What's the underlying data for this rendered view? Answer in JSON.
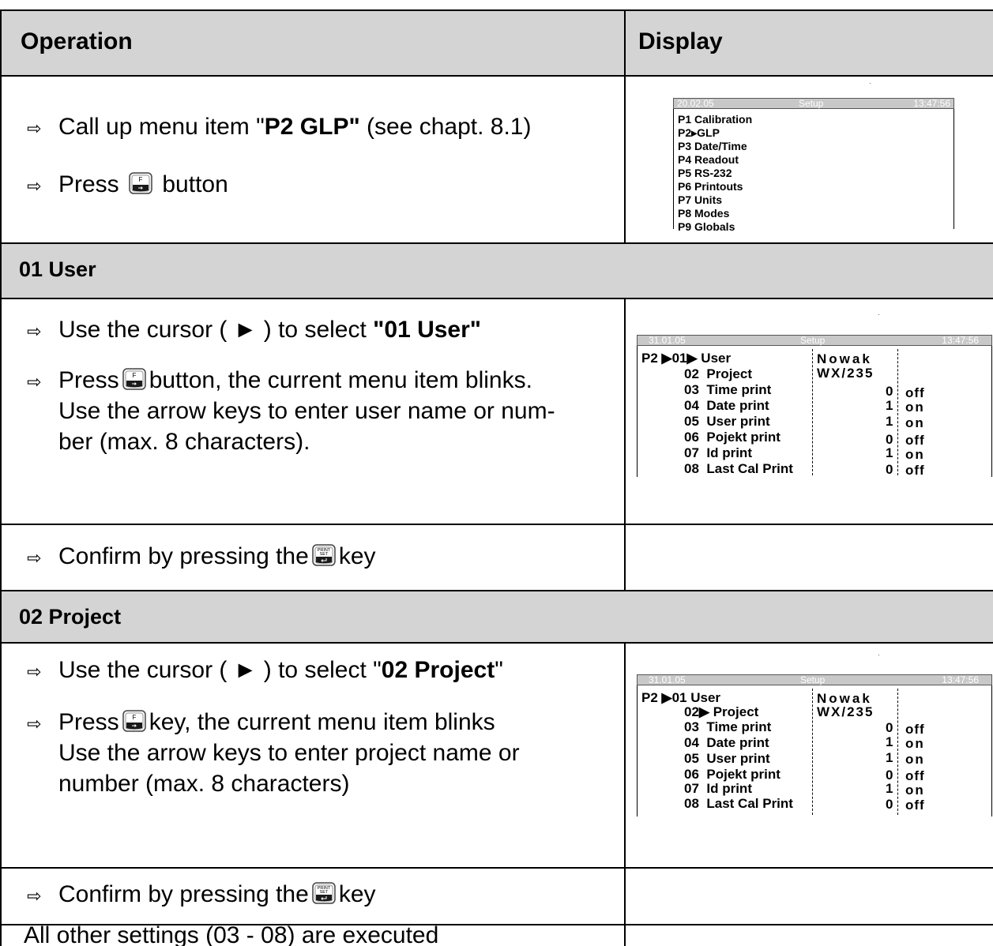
{
  "header": {
    "col1": "Operation",
    "col2": "Display"
  },
  "sec0": {
    "line1_pre": "Call up menu item \"",
    "line1_bold": "P2 GLP\"",
    "line1_post": " (see chapt. 8.1)",
    "line2_pre": "Press",
    "line2_post": "button",
    "display": {
      "bar_date": "20.02.05",
      "bar_title": "Setup",
      "bar_time": "13:47:56",
      "items": [
        "P1  Calibration",
        "P2▸GLP",
        "P3  Date/Time",
        "P4  Readout",
        "P5  RS-232",
        "P6  Printouts",
        "P7  Units",
        "P8  Modes",
        "P9  Globals"
      ]
    }
  },
  "user_section": {
    "title": "01 User",
    "line1_pre": "Use the cursor ( ► ) to select ",
    "line1_bold": "\"01 User\"",
    "line2_pre": "Press",
    "line2_post": "button, the current menu item blinks.",
    "line3": "Use the arrow keys to enter user name or num-",
    "line4": "ber (max. 8 characters).",
    "display": {
      "bar_date": "31.01.05",
      "bar_title": "Setup",
      "bar_time": "13:47:56",
      "prefix": "P2 ▶01▶ User",
      "rows": [
        {
          "num": "02",
          "label": "Project"
        },
        {
          "num": "03",
          "label": "Time print"
        },
        {
          "num": "04",
          "label": "Date print"
        },
        {
          "num": "05",
          "label": "User  print"
        },
        {
          "num": "06",
          "label": "Pojekt print"
        },
        {
          "num": "07",
          "label": "Id print"
        },
        {
          "num": "08",
          "label": "Last Cal Print"
        }
      ],
      "val1": "Nowak",
      "val2": "WX/235",
      "nums": [
        "0",
        "1",
        "1",
        "0",
        "1",
        "0"
      ],
      "states": [
        "off",
        "on",
        "on",
        "off",
        "on",
        "off"
      ]
    },
    "confirm_pre": "Confirm by pressing the",
    "confirm_post": "key"
  },
  "project_section": {
    "title": "02 Project",
    "line1_pre": "Use the cursor ( ► ) to select \"",
    "line1_bold": "02 Project",
    "line1_post": "\"",
    "line2_pre": "Press",
    "line2_post": "key, the current menu item blinks",
    "line3": "Use the arrow keys to enter project name or",
    "line4": "number (max. 8 characters)",
    "display": {
      "bar_date": "31.01.05",
      "bar_title": "Setup",
      "bar_time": "13:47:56",
      "prefix": "P2 ▶01  User",
      "row2": "02▶ Project",
      "rows": [
        {
          "num": "03",
          "label": "Time print"
        },
        {
          "num": "04",
          "label": "Date print"
        },
        {
          "num": "05",
          "label": "User  print"
        },
        {
          "num": "06",
          "label": "Pojekt print"
        },
        {
          "num": "07",
          "label": "Id print"
        },
        {
          "num": "08",
          "label": "Last Cal Print"
        }
      ],
      "val1": "Nowak",
      "val2": "WX/235",
      "nums": [
        "0",
        "1",
        "1",
        "0",
        "1",
        "0"
      ],
      "states": [
        "off",
        "on",
        "on",
        "off",
        "on",
        "off"
      ]
    },
    "confirm_pre": "Confirm by pressing the",
    "confirm_post": "key"
  },
  "footer": {
    "text": "All other settings (03 - 08) are executed"
  },
  "icons": {
    "arrow": "⇨"
  }
}
